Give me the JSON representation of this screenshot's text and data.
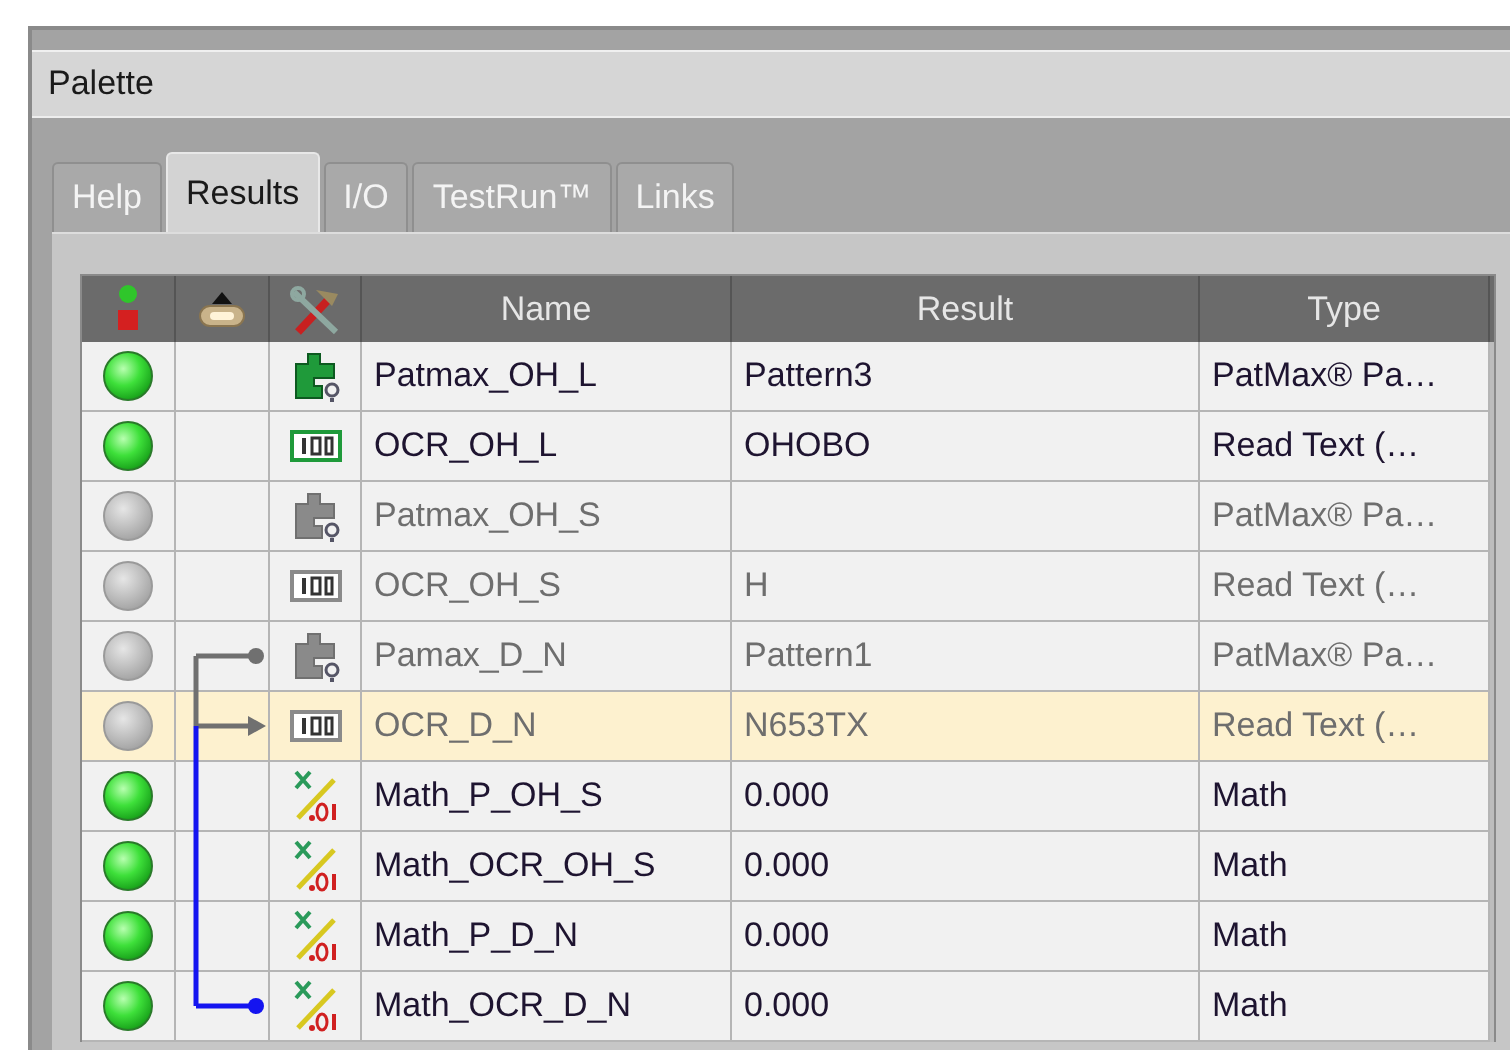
{
  "window": {
    "title": "Palette"
  },
  "tabs": [
    {
      "label": "Help",
      "selected": false
    },
    {
      "label": "Results",
      "selected": true
    },
    {
      "label": "I/O",
      "selected": false
    },
    {
      "label": "TestRun™",
      "selected": false
    },
    {
      "label": "Links",
      "selected": false
    }
  ],
  "table": {
    "columns": [
      "Name",
      "Result",
      "Type"
    ],
    "rows": [
      {
        "passed": true,
        "enabled": true,
        "selected": false,
        "kind": "pattern",
        "name": "Patmax_OH_L",
        "result": "Pattern3",
        "type": "PatMax® Pa…"
      },
      {
        "passed": true,
        "enabled": true,
        "selected": false,
        "kind": "ocr",
        "name": "OCR_OH_L",
        "result": "OHOBO",
        "type": "Read Text (…"
      },
      {
        "passed": false,
        "enabled": false,
        "selected": false,
        "kind": "pattern",
        "name": "Patmax_OH_S",
        "type": "PatMax® Pa…"
      },
      {
        "passed": false,
        "enabled": false,
        "selected": false,
        "kind": "ocr",
        "name": "OCR_OH_S",
        "result": "H",
        "type": "Read Text (…"
      },
      {
        "passed": false,
        "enabled": false,
        "selected": false,
        "kind": "pattern",
        "name": "Pamax_D_N",
        "result": "Pattern1",
        "type": "PatMax® Pa…",
        "link": {
          "kind": "dot",
          "color": "#707070"
        }
      },
      {
        "passed": false,
        "enabled": false,
        "selected": true,
        "kind": "ocr",
        "name": "OCR_D_N",
        "result": "N653TX",
        "type": "Read Text (…",
        "link": {
          "kind": "arrow",
          "color": "#707070"
        }
      },
      {
        "passed": true,
        "enabled": true,
        "selected": false,
        "kind": "math",
        "name": "Math_P_OH_S",
        "result": "0.000",
        "type": "Math"
      },
      {
        "passed": true,
        "enabled": true,
        "selected": false,
        "kind": "math",
        "name": "Math_OCR_OH_S",
        "result": "0.000",
        "type": "Math"
      },
      {
        "passed": true,
        "enabled": true,
        "selected": false,
        "kind": "math",
        "name": "Math_P_D_N",
        "result": "0.000",
        "type": "Math"
      },
      {
        "passed": true,
        "enabled": true,
        "selected": false,
        "kind": "math",
        "name": "Math_OCR_D_N",
        "result": "0.000",
        "type": "Math",
        "link": {
          "kind": "dot",
          "color": "#1414f0"
        }
      }
    ]
  }
}
